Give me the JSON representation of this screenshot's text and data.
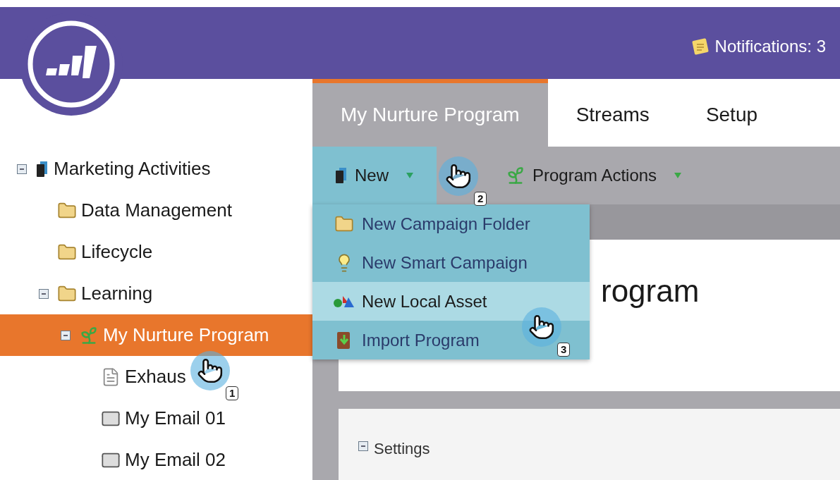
{
  "header": {
    "notifications": "Notifications: 3"
  },
  "tree": [
    {
      "label": "Marketing Activities",
      "kind": "activities",
      "expanded": true,
      "selected": false,
      "children": [
        {
          "label": "Data Management",
          "kind": "folder",
          "selected": false
        },
        {
          "label": "Lifecycle",
          "kind": "folder",
          "selected": false
        },
        {
          "label": "Learning",
          "kind": "folder",
          "expanded": true,
          "selected": false,
          "children": [
            {
              "label": "My Nurture Program",
              "kind": "program",
              "expanded": true,
              "selected": true,
              "children": [
                {
                  "label": "Exhaus",
                  "kind": "page",
                  "selected": false
                },
                {
                  "label": "My Email 01",
                  "kind": "email",
                  "selected": false
                },
                {
                  "label": "My Email 02",
                  "kind": "email",
                  "selected": false
                }
              ]
            }
          ]
        }
      ]
    }
  ],
  "tabs": [
    {
      "label": "My Nurture Program",
      "selected": true
    },
    {
      "label": "Streams",
      "selected": false
    },
    {
      "label": "Setup",
      "selected": false
    }
  ],
  "toolbar": [
    {
      "label": "New",
      "kind": "new",
      "open": true
    },
    {
      "label": "Program Actions",
      "kind": "actions",
      "open": false
    }
  ],
  "menu": [
    {
      "label": "New Campaign Folder",
      "kind": "folder",
      "selected": false
    },
    {
      "label": "New Smart Campaign",
      "kind": "smart",
      "selected": false
    },
    {
      "label": "New Local Asset",
      "kind": "asset",
      "selected": true
    },
    {
      "label": "Import Program",
      "kind": "import",
      "selected": false
    }
  ],
  "page_title": "rogram",
  "settings": {
    "label": "Settings",
    "expanded": true
  },
  "steps": [
    {
      "number": "1"
    },
    {
      "number": "2"
    },
    {
      "number": "3"
    }
  ]
}
